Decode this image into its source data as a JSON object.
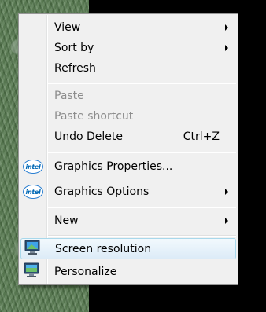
{
  "context_menu": {
    "items": [
      {
        "label": "View",
        "submenu": true,
        "disabled": false
      },
      {
        "label": "Sort by",
        "submenu": true,
        "disabled": false
      },
      {
        "label": "Refresh",
        "submenu": false,
        "disabled": false
      },
      {
        "label": "Paste",
        "submenu": false,
        "disabled": true
      },
      {
        "label": "Paste shortcut",
        "submenu": false,
        "disabled": true
      },
      {
        "label": "Undo Delete",
        "shortcut": "Ctrl+Z",
        "submenu": false,
        "disabled": false
      },
      {
        "label": "Graphics Properties...",
        "icon": "intel-icon",
        "icon_text": "intel",
        "submenu": false,
        "disabled": false
      },
      {
        "label": "Graphics Options",
        "icon": "intel-icon",
        "icon_text": "intel",
        "submenu": true,
        "disabled": false
      },
      {
        "label": "New",
        "submenu": true,
        "disabled": false
      },
      {
        "label": "Screen resolution",
        "icon": "monitor-icon",
        "submenu": false,
        "disabled": false,
        "highlighted": true
      },
      {
        "label": "Personalize",
        "icon": "monitor-icon",
        "submenu": false,
        "disabled": false
      }
    ]
  },
  "colors": {
    "menu_background": "#f0f0f0",
    "menu_border": "#979797",
    "disabled_text": "#8d8d8d",
    "hover_border": "#a8d8eb",
    "intel_blue": "#0068b5"
  }
}
